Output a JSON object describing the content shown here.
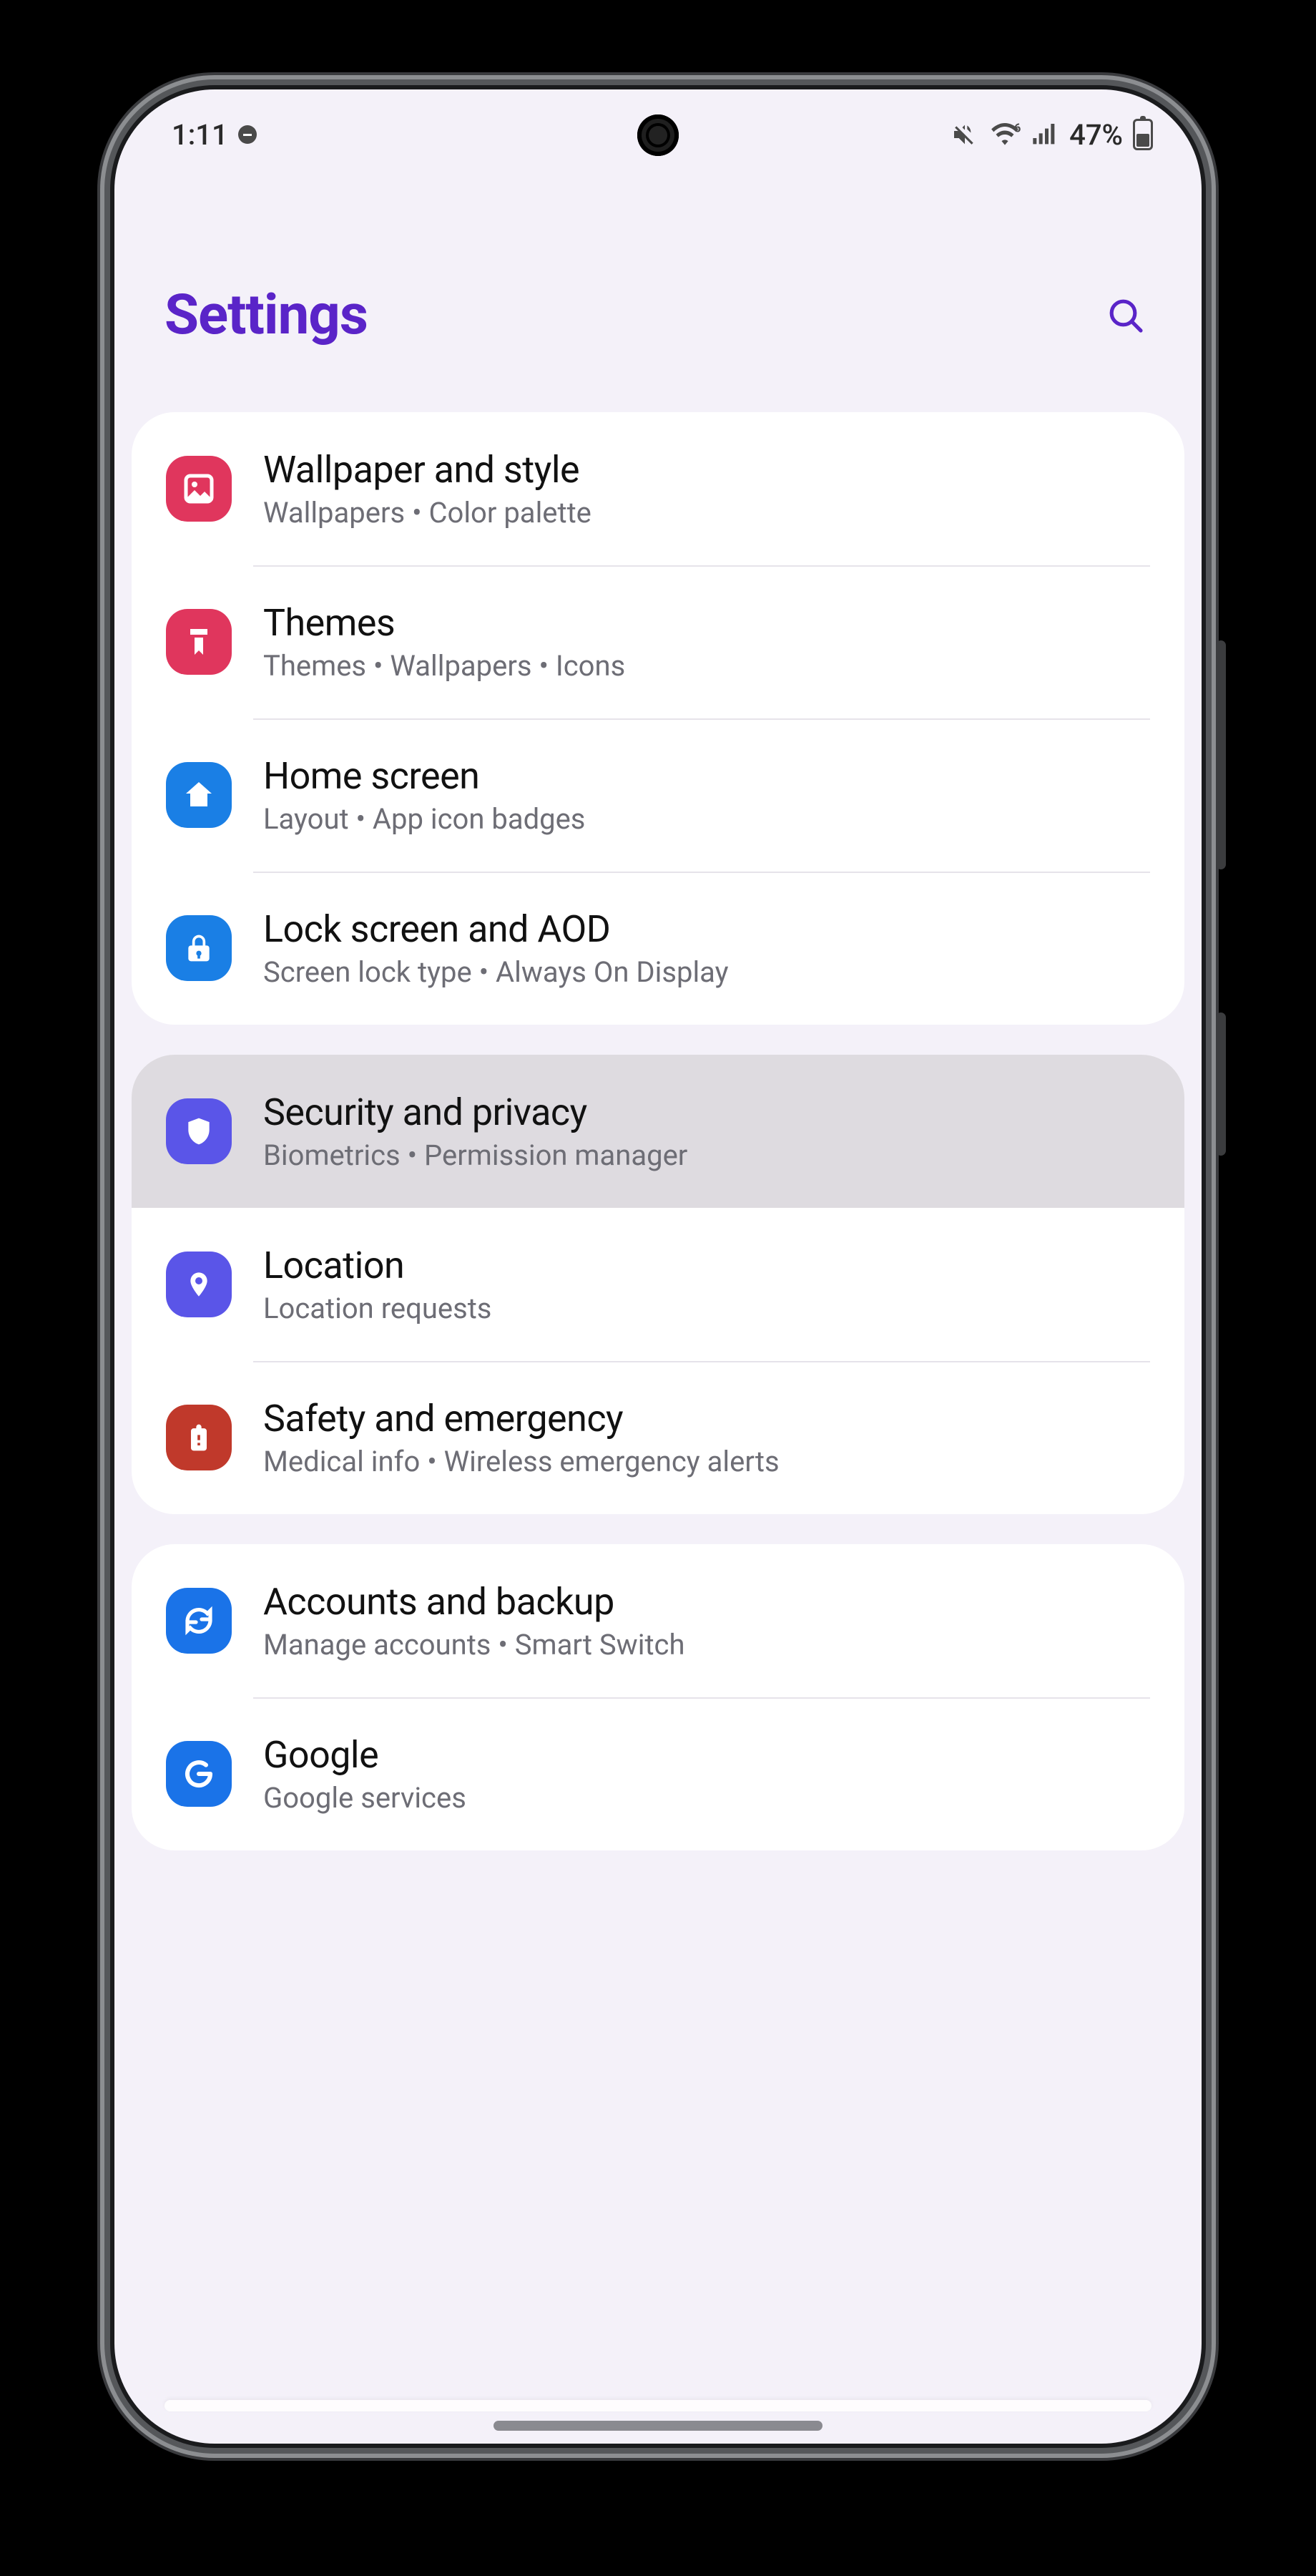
{
  "statusbar": {
    "time": "1:11",
    "battery_pct": "47%",
    "icons": {
      "dnd": "do-not-disturb",
      "mute": "volume-mute",
      "wifi": "wifi-6",
      "data_arrows": "data-up-down",
      "signal": "cell-signal-full",
      "battery": "battery-47"
    }
  },
  "header": {
    "title": "Settings"
  },
  "groups": [
    {
      "rows": [
        {
          "id": "wallpaper",
          "icon": "wallpaper-icon",
          "color": "#e0365d",
          "title": "Wallpaper and style",
          "sub": "Wallpapers  •  Color palette"
        },
        {
          "id": "themes",
          "icon": "themes-icon",
          "color": "#e0365d",
          "title": "Themes",
          "sub": "Themes  •  Wallpapers  •  Icons"
        },
        {
          "id": "home",
          "icon": "home-icon",
          "color": "#1a7fe5",
          "title": "Home screen",
          "sub": "Layout  •  App icon badges"
        },
        {
          "id": "lock",
          "icon": "lock-icon",
          "color": "#1a7fe5",
          "title": "Lock screen and AOD",
          "sub": "Screen lock type  •  Always On Display"
        }
      ]
    },
    {
      "rows": [
        {
          "id": "security",
          "icon": "shield-icon",
          "color": "#5a55e8",
          "title": "Security and privacy",
          "sub": "Biometrics  •  Permission manager",
          "highlight": true
        },
        {
          "id": "location",
          "icon": "location-icon",
          "color": "#5a55e8",
          "title": "Location",
          "sub": "Location requests"
        },
        {
          "id": "safety",
          "icon": "safety-icon",
          "color": "#c0392b",
          "title": "Safety and emergency",
          "sub": "Medical info  •  Wireless emergency alerts"
        }
      ]
    },
    {
      "rows": [
        {
          "id": "accounts",
          "icon": "sync-icon",
          "color": "#1a73e8",
          "title": "Accounts and backup",
          "sub": "Manage accounts  •  Smart Switch"
        },
        {
          "id": "google",
          "icon": "google-icon",
          "color": "#1a73e8",
          "title": "Google",
          "sub": "Google services"
        }
      ]
    }
  ]
}
